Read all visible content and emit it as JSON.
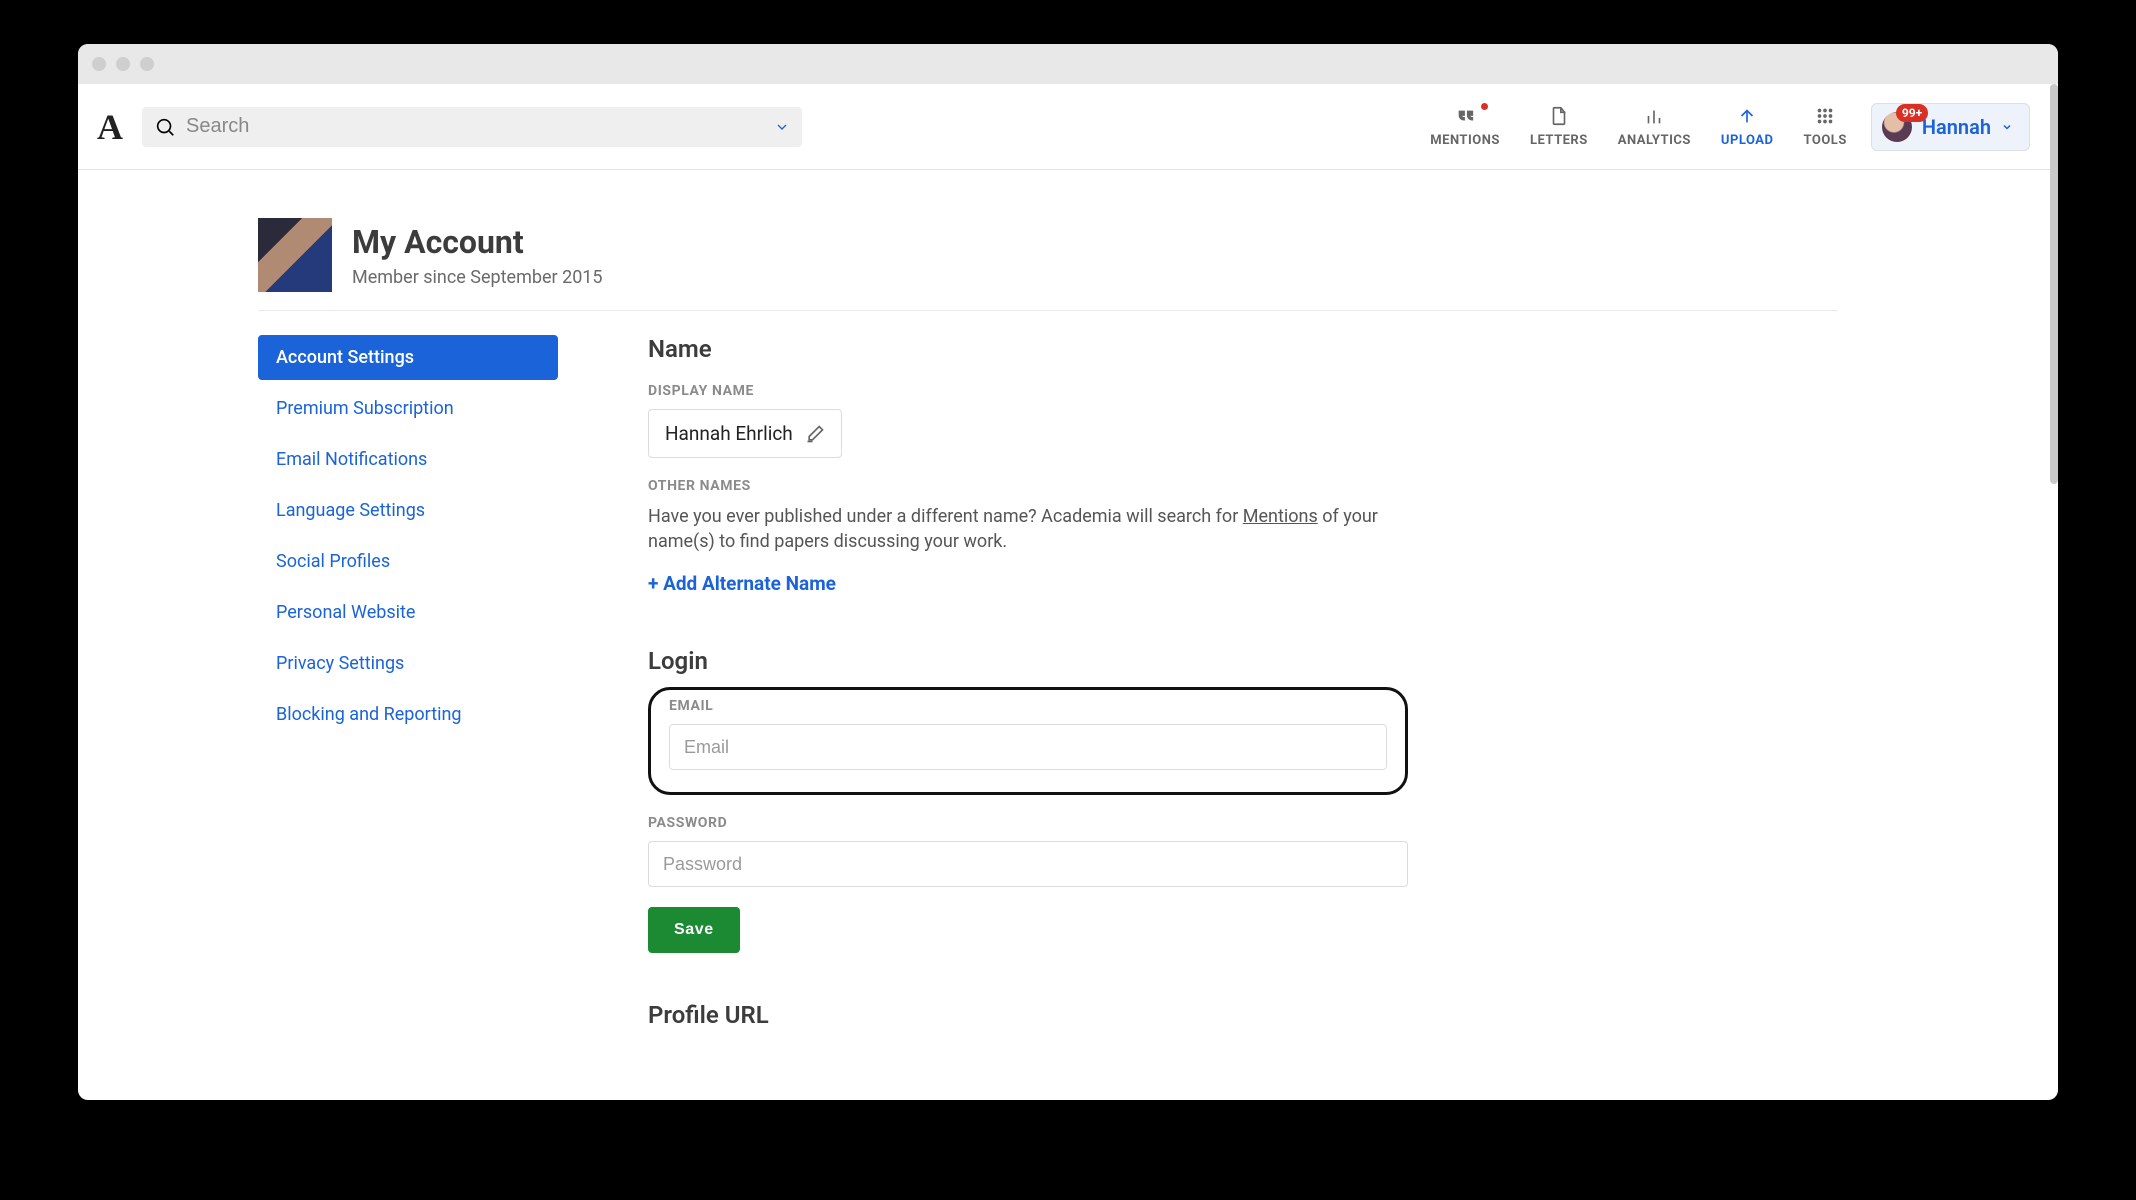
{
  "search": {
    "placeholder": "Search"
  },
  "nav": {
    "mentions": "Mentions",
    "letters": "Letters",
    "analytics": "Analytics",
    "upload": "Upload",
    "tools": "Tools"
  },
  "user": {
    "name": "Hannah",
    "badge": "99+"
  },
  "page": {
    "title": "My Account",
    "subtitle": "Member since September 2015"
  },
  "sidebar": {
    "items": [
      "Account Settings",
      "Premium Subscription",
      "Email Notifications",
      "Language Settings",
      "Social Profiles",
      "Personal Website",
      "Privacy Settings",
      "Blocking and Reporting"
    ],
    "active_index": 0
  },
  "section_name": {
    "heading": "Name",
    "display_name_label": "Display Name",
    "display_name_value": "Hannah Ehrlich",
    "other_names_label": "Other Names",
    "hint_pre": "Have you ever published under a different name? Academia will search for ",
    "hint_link": "Mentions",
    "hint_post": " of your name(s) to find papers discussing your work.",
    "add_alternate": "+ Add Alternate Name"
  },
  "section_login": {
    "heading": "Login",
    "email_label": "Email",
    "email_placeholder": "Email",
    "password_label": "Password",
    "password_placeholder": "Password",
    "save": "Save"
  },
  "section_profile_url": {
    "heading": "Profile URL"
  }
}
